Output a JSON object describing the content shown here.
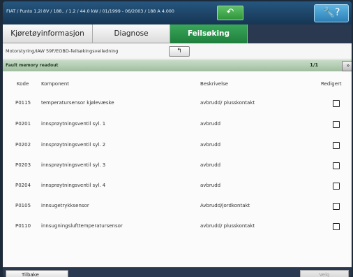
{
  "titlebar": {
    "vehicle_info": "FIAT / Punto 1.2i 8V / 188.. / 1.2 / 44.0 kW / 01/1999 - 06/2003 / 188 A 4.000",
    "back_icon": "green-return-arrow",
    "tools_icon": "wrench-question"
  },
  "tabs": [
    {
      "label": "Kjøretøyinformasjon",
      "active": false
    },
    {
      "label": "Diagnose",
      "active": false
    },
    {
      "label": "Feilsøking",
      "active": true
    }
  ],
  "breadcrumb": "Motorstyring/IAW 59F/EOBD-feilsøkingsveiledning",
  "fault_bar": {
    "label": "Fault memory readout",
    "count": "1/1"
  },
  "table": {
    "headers": [
      "Kode",
      "Komponent",
      "Beskrivelse",
      "Redigert"
    ],
    "rows": [
      {
        "code": "P0115",
        "component": "temperatursensor kjølevæske",
        "description": "avbrudd/ plusskontakt"
      },
      {
        "code": "P0201",
        "component": "innsprøytningsventil syl. 1",
        "description": "avbrudd"
      },
      {
        "code": "P0202",
        "component": "innsprøytningsventil syl. 2",
        "description": "avbrudd"
      },
      {
        "code": "P0203",
        "component": "innsprøytningsventil syl. 3",
        "description": "avbrudd"
      },
      {
        "code": "P0204",
        "component": "innsprøytningsventil syl. 4",
        "description": "avbrudd"
      },
      {
        "code": "P0105",
        "component": "innsugetrykksensor",
        "description": "Avbrudd/jordkontakt"
      },
      {
        "code": "P0110",
        "component": "innsugningslufttemperatursensor",
        "description": "avbrudd/ plusskontakt"
      }
    ]
  },
  "footer": {
    "back_label": "Tilbake",
    "select_label": "Velg"
  },
  "colors": {
    "active_tab": "#2a9148",
    "title_bar": "#1e4a6e",
    "frame": "#2a3850"
  }
}
